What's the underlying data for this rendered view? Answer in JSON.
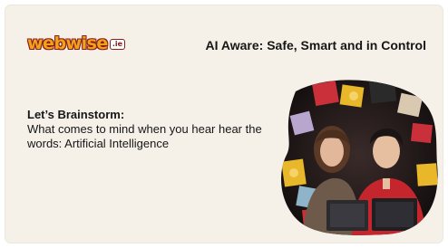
{
  "logo": {
    "text": "webwise",
    "badge": ".ie"
  },
  "header": {
    "title": "AI Aware: Safe, Smart and in Control"
  },
  "prompt": {
    "heading": "Let’s Brainstorm:",
    "body": "What comes to mind when you hear hear the words: Artificial Intelligence"
  },
  "colors": {
    "background": "#f5f1e8",
    "logo_fill": "#f0a21a",
    "logo_outline": "#8a1d1d",
    "text": "#161616"
  }
}
